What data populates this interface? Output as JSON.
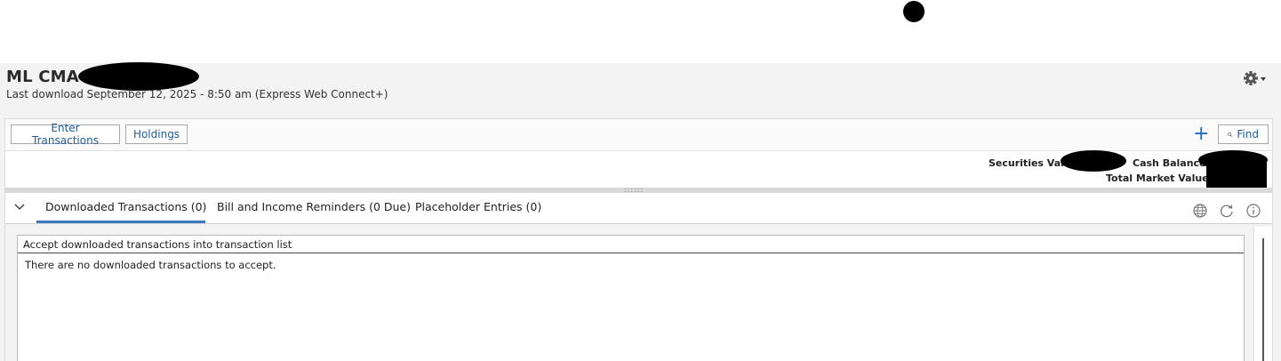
{
  "account": {
    "title": "ML CMA",
    "subtitle_visible": "Last download September 12, 2025 - 8:50 am (Express Web Connect+)"
  },
  "toolbar": {
    "enter_transactions_label": "Enter Transactions",
    "holdings_label": "Holdings",
    "add_icon": "plus-icon",
    "find_label": "Find",
    "find_icon": "magnifier-icon",
    "settings_icon": "gear-icon"
  },
  "values": {
    "securities_label": "Securities Value:",
    "cash_label": "Cash Balance:",
    "total_label": "Total Market Value:"
  },
  "tabs": [
    {
      "label": "Downloaded Transactions (0)",
      "active": true
    },
    {
      "label": "Bill and Income Reminders (0 Due)",
      "active": false
    },
    {
      "label": "Placeholder Entries (0)",
      "active": false
    }
  ],
  "tab_actions": {
    "icons": [
      "globe-icon",
      "refresh-icon",
      "info-icon"
    ]
  },
  "list": {
    "header": "Accept downloaded transactions into transaction list",
    "empty_message": "There are no downloaded transactions to accept."
  },
  "colors": {
    "accent": "#1a6fc4",
    "button_text": "#1f5fa0",
    "tab_underline": "#3a7bbf"
  }
}
